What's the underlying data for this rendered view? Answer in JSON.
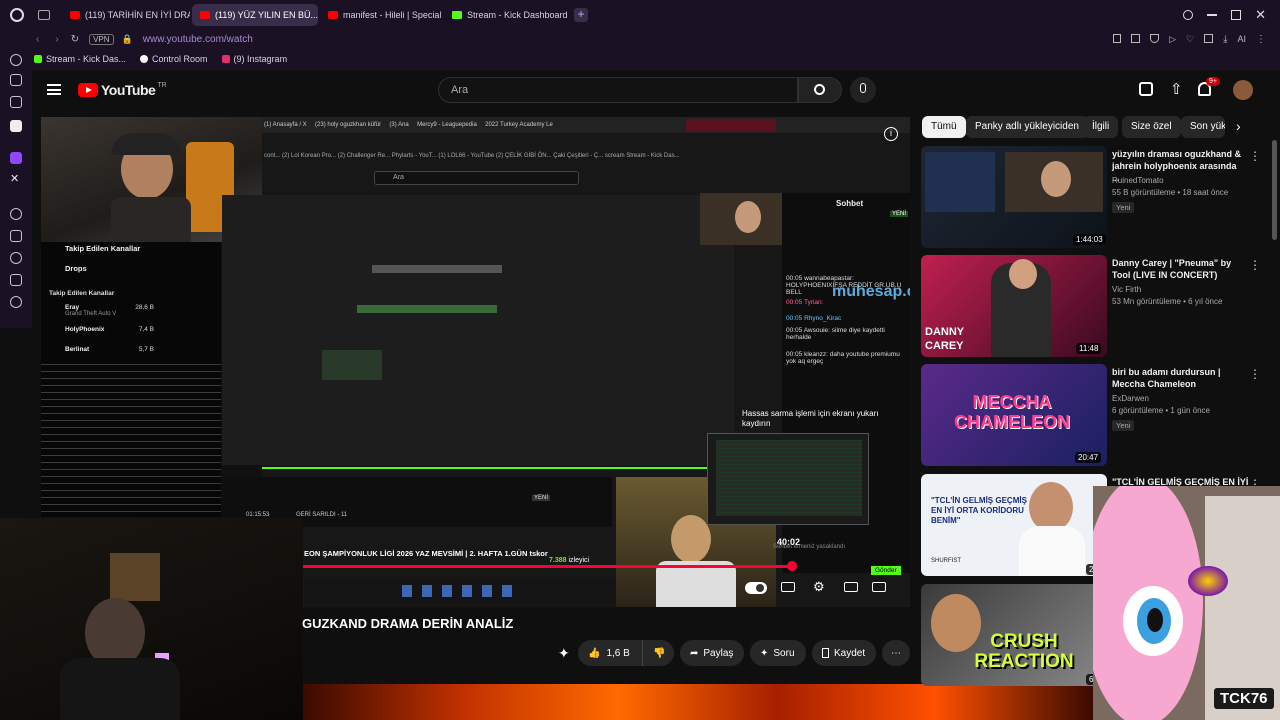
{
  "tabs": [
    {
      "label": "(119) TARİHİN EN İYİ DRAMA...",
      "type": "yt",
      "active": false
    },
    {
      "label": "(119) YÜZ YILIN EN BÜ...",
      "type": "yt",
      "active": true
    },
    {
      "label": "manifest - Hileli | Special D...",
      "type": "yt",
      "active": false
    },
    {
      "label": "Stream - Kick Dashboard",
      "type": "kick",
      "active": false
    }
  ],
  "url": "www.youtube.com/watch",
  "vpn_label": "VPN",
  "bookmarks": [
    {
      "label": "Stream - Kick Das...",
      "color": "#53fc18"
    },
    {
      "label": "Control Room",
      "color": "#ffffff"
    },
    {
      "label": "(9) Instagram",
      "color": "#e1306c"
    }
  ],
  "yt": {
    "logo": "YouTube",
    "region": "TR",
    "search_placeholder": "Ara",
    "notif_count": "9+"
  },
  "video": {
    "inner_search": "Ara",
    "followed_header": "Takip Edilen Kanallar",
    "drops": "Drops",
    "followed_label": "Takip Edilen Kanallar",
    "channels": [
      {
        "name": "Eray",
        "game": "Grand Theft Auto V",
        "viewers": "28,6 B"
      },
      {
        "name": "HolyPhoenix",
        "game": "",
        "viewers": "7,4 B"
      },
      {
        "name": "Berlinat",
        "game": "",
        "viewers": "5,7 B"
      }
    ],
    "chat_title": "Sohbet",
    "chat_new": "YENİ",
    "chat_lines": [
      "00:05 wannabeapastar: HOLYPHOENIXİFŞA REDDİT GR.UB.U BELL",
      "00:05 Tyrian:",
      "00:05 Rhyno_Kirac",
      "00:05 Awsouie: silme diye kaydetti herhalde",
      "00:05 kleanzz: daha youtube premiumu yok aq ergeç"
    ],
    "watermark": "muhesap.com",
    "hassas_text": "Hassas sarma işlemi için ekranı yukarı kaydırın",
    "time_display": "40:02",
    "chat_placeholder": "Sohbet etmeniz yasaklandı",
    "send_label": "Gönder",
    "viewer_count": "7.388",
    "viewer_suffix": "izleyici",
    "stream_title": "EON ŞAMPİYONLUK LİGİ 2026 YAZ MEVSİMİ | 2. HAFTA 1.GÜN tskor",
    "back_label": "GERİ SARILDI - 11",
    "time_elapsed": "01:15:53",
    "yeni_label": "YENİ"
  },
  "video_title": "GUZKAND DRAMA DERİN ANALİZ",
  "actions": {
    "likes": "1,6 B",
    "share": "Paylaş",
    "ask": "Soru",
    "save": "Kaydet"
  },
  "chips": [
    "Tümü",
    "Panky adlı yükleyiciden",
    "İlgili",
    "Size özel",
    "Son yük"
  ],
  "recommendations": [
    {
      "title": "yüzyılın draması oguzkhand & jahrein holyphoenix arasında ...",
      "channel": "RuinedTomato",
      "meta": "55 B görüntüleme • 18 saat önce",
      "badge": "Yeni",
      "duration": "1:44:03"
    },
    {
      "title": "Danny Carey | \"Pneuma\" by Tool (LIVE IN CONCERT)",
      "channel": "Vic Firth",
      "meta": "53 Mn görüntüleme • 6 yıl önce",
      "badge": "",
      "duration": "11:48"
    },
    {
      "title": "biri bu adamı durdursun | Meccha Chameleon",
      "channel": "ExDarwen",
      "meta": "6 görüntüleme • 1 gün önce",
      "badge": "Yeni",
      "duration": "20:47"
    },
    {
      "title": "\"TCL'İN GELMİŞ GEÇMİŞ EN İYİ",
      "channel": "",
      "meta": "",
      "badge": "",
      "duration": "25:"
    },
    {
      "title": "",
      "channel": "",
      "meta": "",
      "badge": "",
      "duration": "6:"
    }
  ],
  "thumb_texts": {
    "danny_carey": "DANNY CAREY",
    "meccha": "MECCHA CHAMELEON",
    "tcl_quote": "\"TCL'İN GELMİŞ GEÇMİŞ EN İYİ ORTA KORİDORU BENİM\"",
    "shurfist": "SHURFIST",
    "crush": "CRUSH REACTION"
  },
  "overlay_name": "TCK76",
  "colors": {
    "browser_bg": "#1b1125",
    "yt_red": "#ff0000",
    "kick_green": "#53fc18",
    "progress_red": "#ff0033"
  }
}
